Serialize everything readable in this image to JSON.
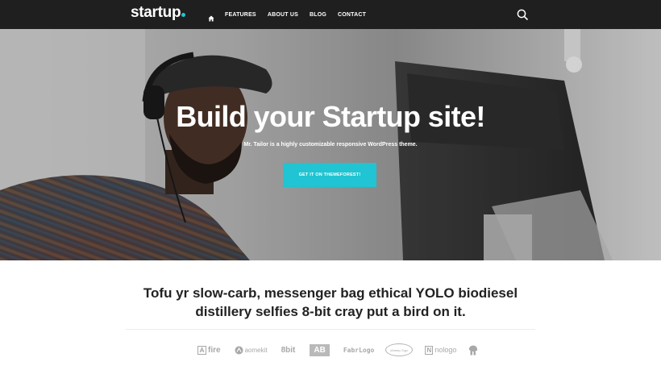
{
  "header": {
    "logo_text": "startup",
    "menu": [
      {
        "label": "FEATURES"
      },
      {
        "label": "ABOUT US"
      },
      {
        "label": "BLOG"
      },
      {
        "label": "CONTACT"
      }
    ],
    "home_icon": "home-icon",
    "search_icon": "search-icon"
  },
  "hero": {
    "title": "Build your Startup site!",
    "subtitle": "Mr. Tailor is a highly customizable responsive WordPress theme.",
    "cta_label": "GET IT ON THEMEFOREST!"
  },
  "tagline": {
    "line1": "Tofu yr slow-carb, messenger bag ethical YOLO biodiesel",
    "line2": "distillery selfies 8-bit cray put a bird on it."
  },
  "client_logos": [
    {
      "name": "fire"
    },
    {
      "name": "aomekit"
    },
    {
      "name": "8bit"
    },
    {
      "name": "AB"
    },
    {
      "name": "FabrLogo"
    },
    {
      "name": "dummy logo"
    },
    {
      "name": "nologo"
    }
  ],
  "colors": {
    "accent": "#20c4d2",
    "nav_bg": "#1f1f1f",
    "text_dark": "#222222",
    "logo_gray": "#a8a8a8"
  }
}
